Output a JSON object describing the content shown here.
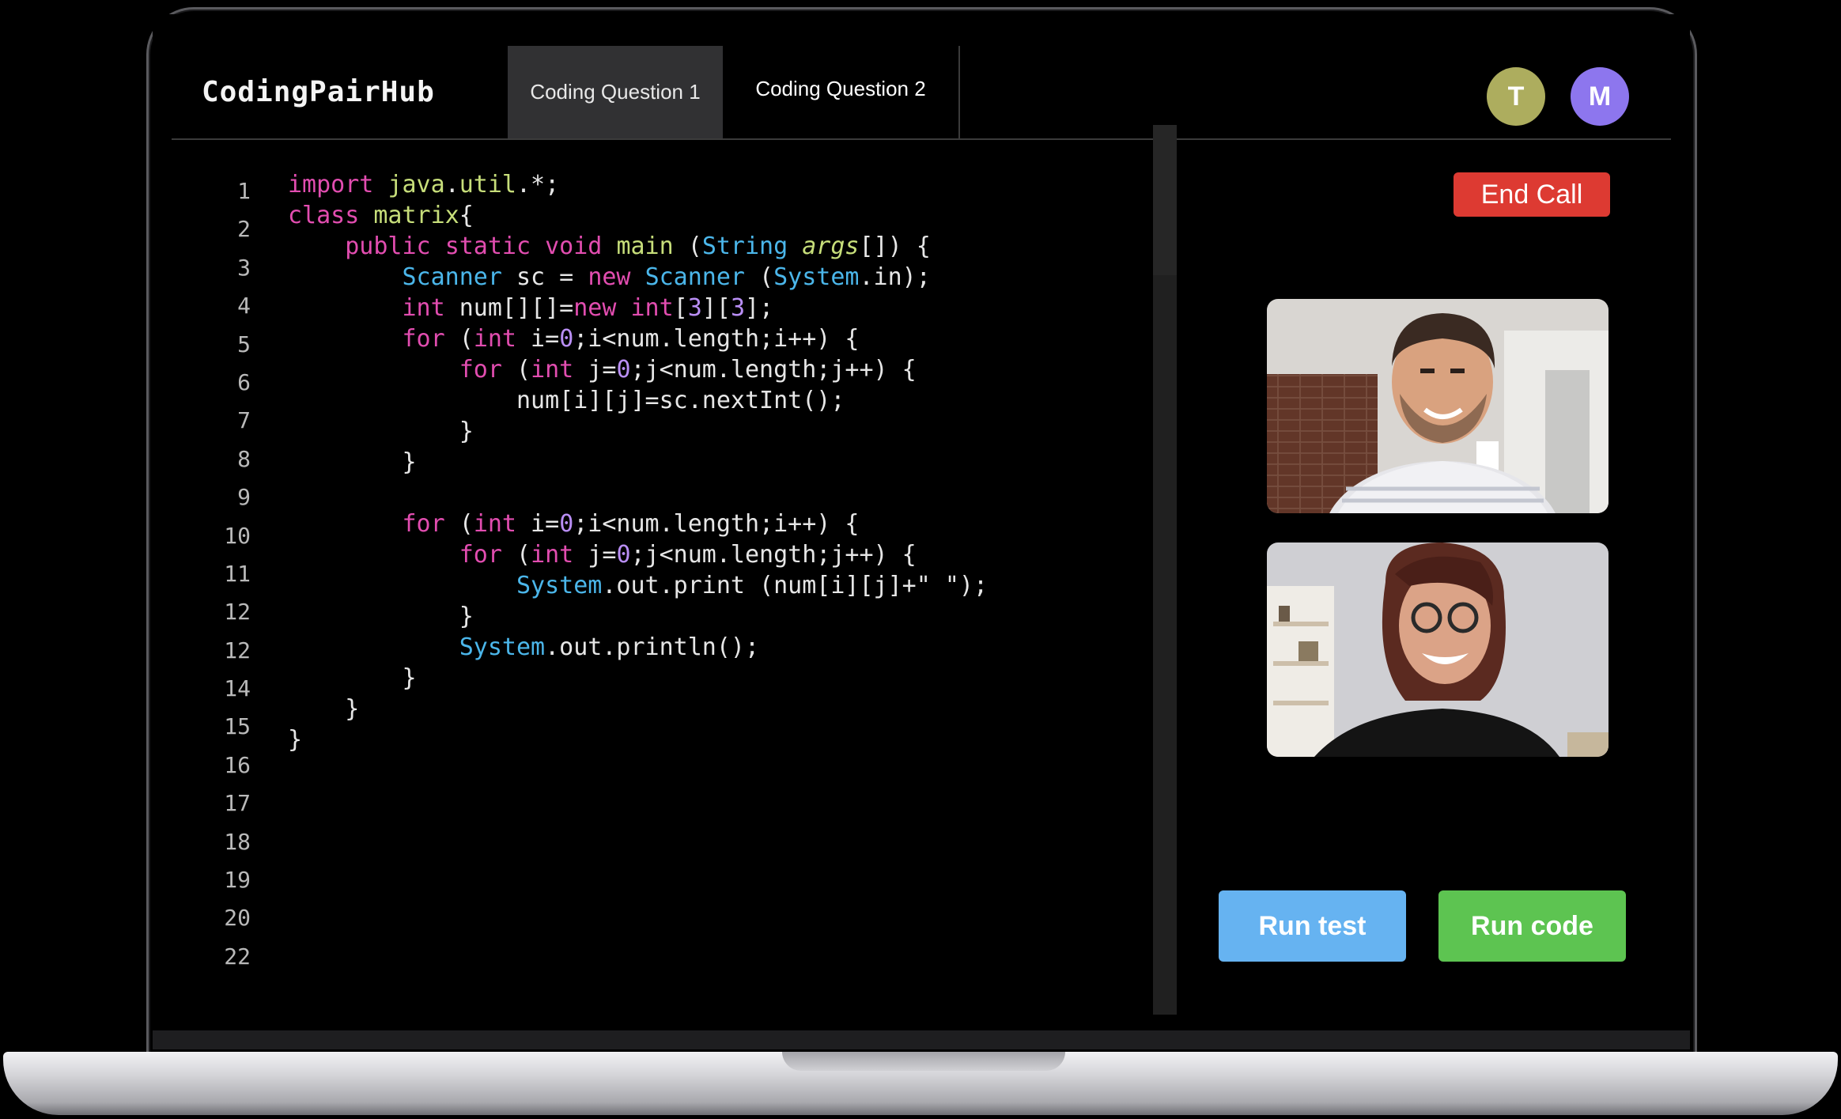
{
  "app": {
    "logo": "CodingPairHub"
  },
  "tabs": [
    {
      "label": "Coding Question 1",
      "active": true
    },
    {
      "label": "Coding Question 2",
      "active": false
    }
  ],
  "participants": [
    {
      "initial": "T",
      "color": "#adad5e"
    },
    {
      "initial": "M",
      "color": "#8d76ee"
    }
  ],
  "editor": {
    "line_numbers": [
      "1",
      "2",
      "3",
      "4",
      "5",
      "6",
      "7",
      "8",
      "9",
      "10",
      "11",
      "12",
      "12",
      "14",
      "15",
      "16",
      "17",
      "18",
      "19",
      "20",
      "22"
    ],
    "code_lines": [
      "import java.util.*;",
      "class matrix{",
      "    public static void main (String args[]) {",
      "        Scanner sc = new Scanner (System.in);",
      "        int num[][]=new int[3][3];",
      "        for (int i=0;i<num.length;i++) {",
      "            for (int j=0;j<num.length;j++) {",
      "                num[i][j]=sc.nextInt();",
      "            }",
      "        }",
      "",
      "        for (int i=0;i<num.length;i++) {",
      "            for (int j=0;j<num.length;j++) {",
      "                System.out.print (num[i][j]+\" \");",
      "            }",
      "            System.out.println();",
      "        }",
      "    }",
      "}"
    ]
  },
  "call": {
    "end_call_label": "End Call",
    "colors": {
      "end_call": "#dd3a32"
    }
  },
  "actions": {
    "run_test_label": "Run test",
    "run_code_label": "Run code",
    "colors": {
      "run_test": "#66b3f1",
      "run_code": "#5dc451"
    }
  }
}
